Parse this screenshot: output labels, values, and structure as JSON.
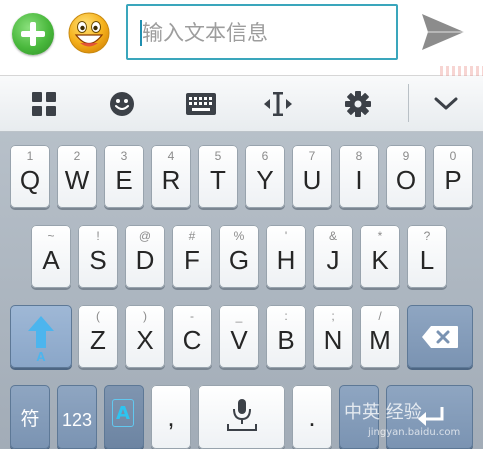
{
  "input_bar": {
    "placeholder": "输入文本信息",
    "plus_icon": "plus-circle-icon",
    "emoji_icon": "smiley-face-icon",
    "send_icon": "send-arrow-icon"
  },
  "toolbar": {
    "items": [
      "grid-icon",
      "emoji-icon",
      "keyboard-icon",
      "cursor-move-icon",
      "settings-gear-icon",
      "chevron-down-icon"
    ]
  },
  "keyboard": {
    "row1": [
      {
        "main": "Q",
        "sub": "1"
      },
      {
        "main": "W",
        "sub": "2"
      },
      {
        "main": "E",
        "sub": "3"
      },
      {
        "main": "R",
        "sub": "4"
      },
      {
        "main": "T",
        "sub": "5"
      },
      {
        "main": "Y",
        "sub": "6"
      },
      {
        "main": "U",
        "sub": "7"
      },
      {
        "main": "I",
        "sub": "8"
      },
      {
        "main": "O",
        "sub": "9"
      },
      {
        "main": "P",
        "sub": "0"
      }
    ],
    "row2": [
      {
        "main": "A",
        "sub": "~"
      },
      {
        "main": "S",
        "sub": "!"
      },
      {
        "main": "D",
        "sub": "@"
      },
      {
        "main": "F",
        "sub": "#"
      },
      {
        "main": "G",
        "sub": "%"
      },
      {
        "main": "H",
        "sub": "'"
      },
      {
        "main": "J",
        "sub": "&"
      },
      {
        "main": "K",
        "sub": "*"
      },
      {
        "main": "L",
        "sub": "?"
      }
    ],
    "row3": [
      {
        "main": "Z",
        "sub": "("
      },
      {
        "main": "X",
        "sub": ")"
      },
      {
        "main": "C",
        "sub": "-"
      },
      {
        "main": "V",
        "sub": "_"
      },
      {
        "main": "B",
        "sub": ":"
      },
      {
        "main": "N",
        "sub": ";"
      },
      {
        "main": "M",
        "sub": "/"
      }
    ],
    "shift_label": "A",
    "symbols_label": "符",
    "numbers_label": "123",
    "lang_label": "A",
    "comma_label": ",",
    "period_label": ".",
    "watermark": "中英 经验",
    "watermark_url": "jingyan.baidu.com"
  },
  "colors": {
    "accent": "#3aa6bc",
    "plus_green": "#49b83c",
    "shift_blue": "#4cb5ee"
  }
}
